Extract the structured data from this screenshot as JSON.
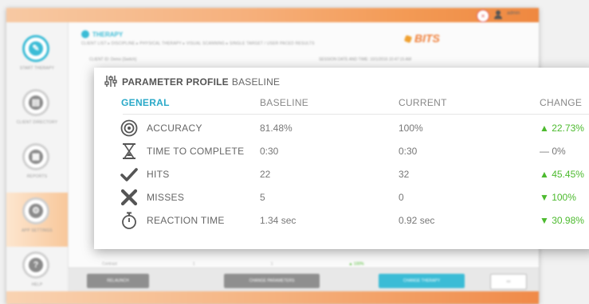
{
  "app": {
    "user_name": "admin",
    "close_label": "×",
    "header_title": "THERAPY",
    "breadcrumb": "CLIENT LIST ▸ DISCIPLINE ▸ PHYSICAL THERAPY ▸ VISUAL SCANNING ▸ SINGLE TARGET / USER PACED RESULTS",
    "logo_text": "BITS",
    "client_line": "CLIENT ID: Demo  [Switch]",
    "session_line": "SESSION DATE AND TIME: 10/1/2016 10:47:15 AM",
    "under_row": [
      "Contrast",
      "1",
      "1",
      "▲ 100%"
    ],
    "sidebar": [
      {
        "label": "START THERAPY",
        "icon": "✎"
      },
      {
        "label": "CLIENT DIRECTORY",
        "icon": "▤"
      },
      {
        "label": "REPORTS",
        "icon": "▦"
      },
      {
        "label": "APP SETTINGS",
        "icon": "⚙"
      },
      {
        "label": "HELP",
        "icon": "?"
      }
    ],
    "bottom_buttons": {
      "relaunch": "RELAUNCH",
      "change_parameters": "CHANGE PARAMETERS",
      "change_therapy": "CHANGE THERAPY",
      "keyboard": "▭"
    }
  },
  "modal": {
    "title": "PARAMETER PROFILE",
    "subtitle": "BASELINE",
    "columns": {
      "general": "GENERAL",
      "baseline": "BASELINE",
      "current": "CURRENT",
      "change": "CHANGE"
    },
    "rows": [
      {
        "icon": "target-icon",
        "label": "ACCURACY",
        "baseline": "81.48%",
        "current": "100%",
        "change": "▲ 22.73%",
        "change_color": "#4cba2e"
      },
      {
        "icon": "hourglass-icon",
        "label": "TIME TO COMPLETE",
        "baseline": "0:30",
        "current": "0:30",
        "change": "— 0%",
        "change_color": "#777777"
      },
      {
        "icon": "checkmark-icon",
        "label": "HITS",
        "baseline": "22",
        "current": "32",
        "change": "▲ 45.45%",
        "change_color": "#4cba2e"
      },
      {
        "icon": "x-mark-icon",
        "label": "MISSES",
        "baseline": "5",
        "current": "0",
        "change": "▼ 100%",
        "change_color": "#4cba2e"
      },
      {
        "icon": "stopwatch-icon",
        "label": "REACTION TIME",
        "baseline": "1.34 sec",
        "current": "0.92 sec",
        "change": "▼ 30.98%",
        "change_color": "#4cba2e"
      }
    ]
  },
  "colors": {
    "accent": "#3bbcd6",
    "brand_orange": "#ef7f39",
    "positive": "#4cba2e"
  }
}
